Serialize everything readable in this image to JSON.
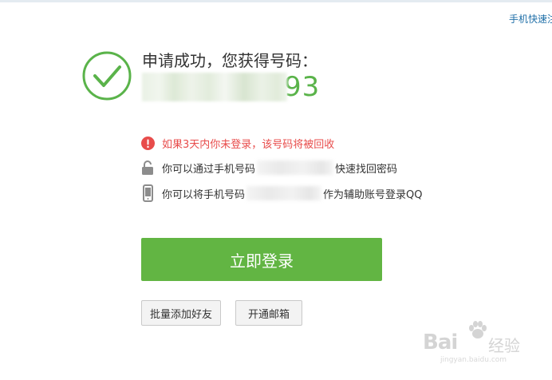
{
  "top_link": "手机快速注",
  "success": {
    "title": "申请成功，您获得号码：",
    "number_visible": "93",
    "accent_color": "#5ab34a"
  },
  "info": {
    "warning": "如果3天内你未登录，该号码将被回收",
    "find_prefix": "你可以通过手机号码",
    "find_suffix": "快速找回密码",
    "login_prefix": "你可以将手机号码",
    "login_suffix": "作为辅助账号登录QQ",
    "warning_color": "#e84c4b"
  },
  "icons": {
    "success": "check-circle-icon",
    "warning": "exclamation-circle-icon",
    "lock": "unlock-icon",
    "phone": "mobile-phone-icon"
  },
  "buttons": {
    "login": "立即登录",
    "add_friends": "批量添加好友",
    "open_mail": "开通邮箱",
    "login_color": "#62b543"
  },
  "watermark": {
    "logo": "Bai",
    "text": "经验",
    "url": "jingyan.baidu.com"
  }
}
